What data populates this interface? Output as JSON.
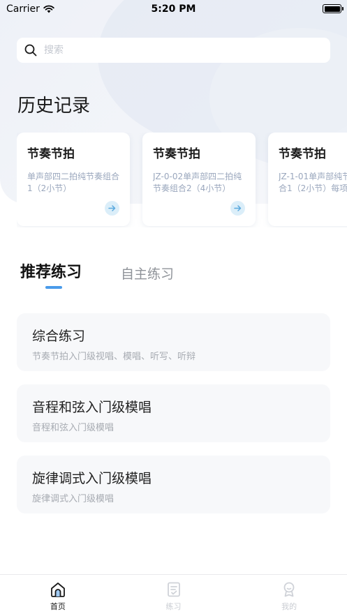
{
  "status_bar": {
    "carrier": "Carrier",
    "time": "5:20 PM"
  },
  "search": {
    "placeholder": "搜索"
  },
  "history": {
    "title": "历史记录",
    "cards": [
      {
        "title": "节奏节拍",
        "desc": "单声部四二拍纯节奏组合1（2小节）"
      },
      {
        "title": "节奏节拍",
        "desc": "JZ-0-02单声部四二拍纯节奏组合2（4小节）"
      },
      {
        "title": "节奏节拍",
        "desc": "JZ-1-01单声部纯节奏组合1（2小节）每项"
      }
    ]
  },
  "tabs": {
    "active": "推荐练习",
    "inactive": "自主练习"
  },
  "practice_list": [
    {
      "title": "综合练习",
      "sub": "节奏节拍入门级视唱、模唱、听写、听辩"
    },
    {
      "title": "音程和弦入门级模唱",
      "sub": "音程和弦入门级模唱"
    },
    {
      "title": "旋律调式入门级模唱",
      "sub": "旋律调式入门级模唱"
    }
  ],
  "tabbar": [
    {
      "label": "首页",
      "icon": "home-icon",
      "active": true
    },
    {
      "label": "练习",
      "icon": "practice-icon",
      "active": false
    },
    {
      "label": "我的",
      "icon": "profile-icon",
      "active": false
    }
  ],
  "colors": {
    "accent": "#4a9bea",
    "arrow_bg": "#dbeef9",
    "arrow": "#5aa9de",
    "muted_text": "#9aa7bd"
  }
}
